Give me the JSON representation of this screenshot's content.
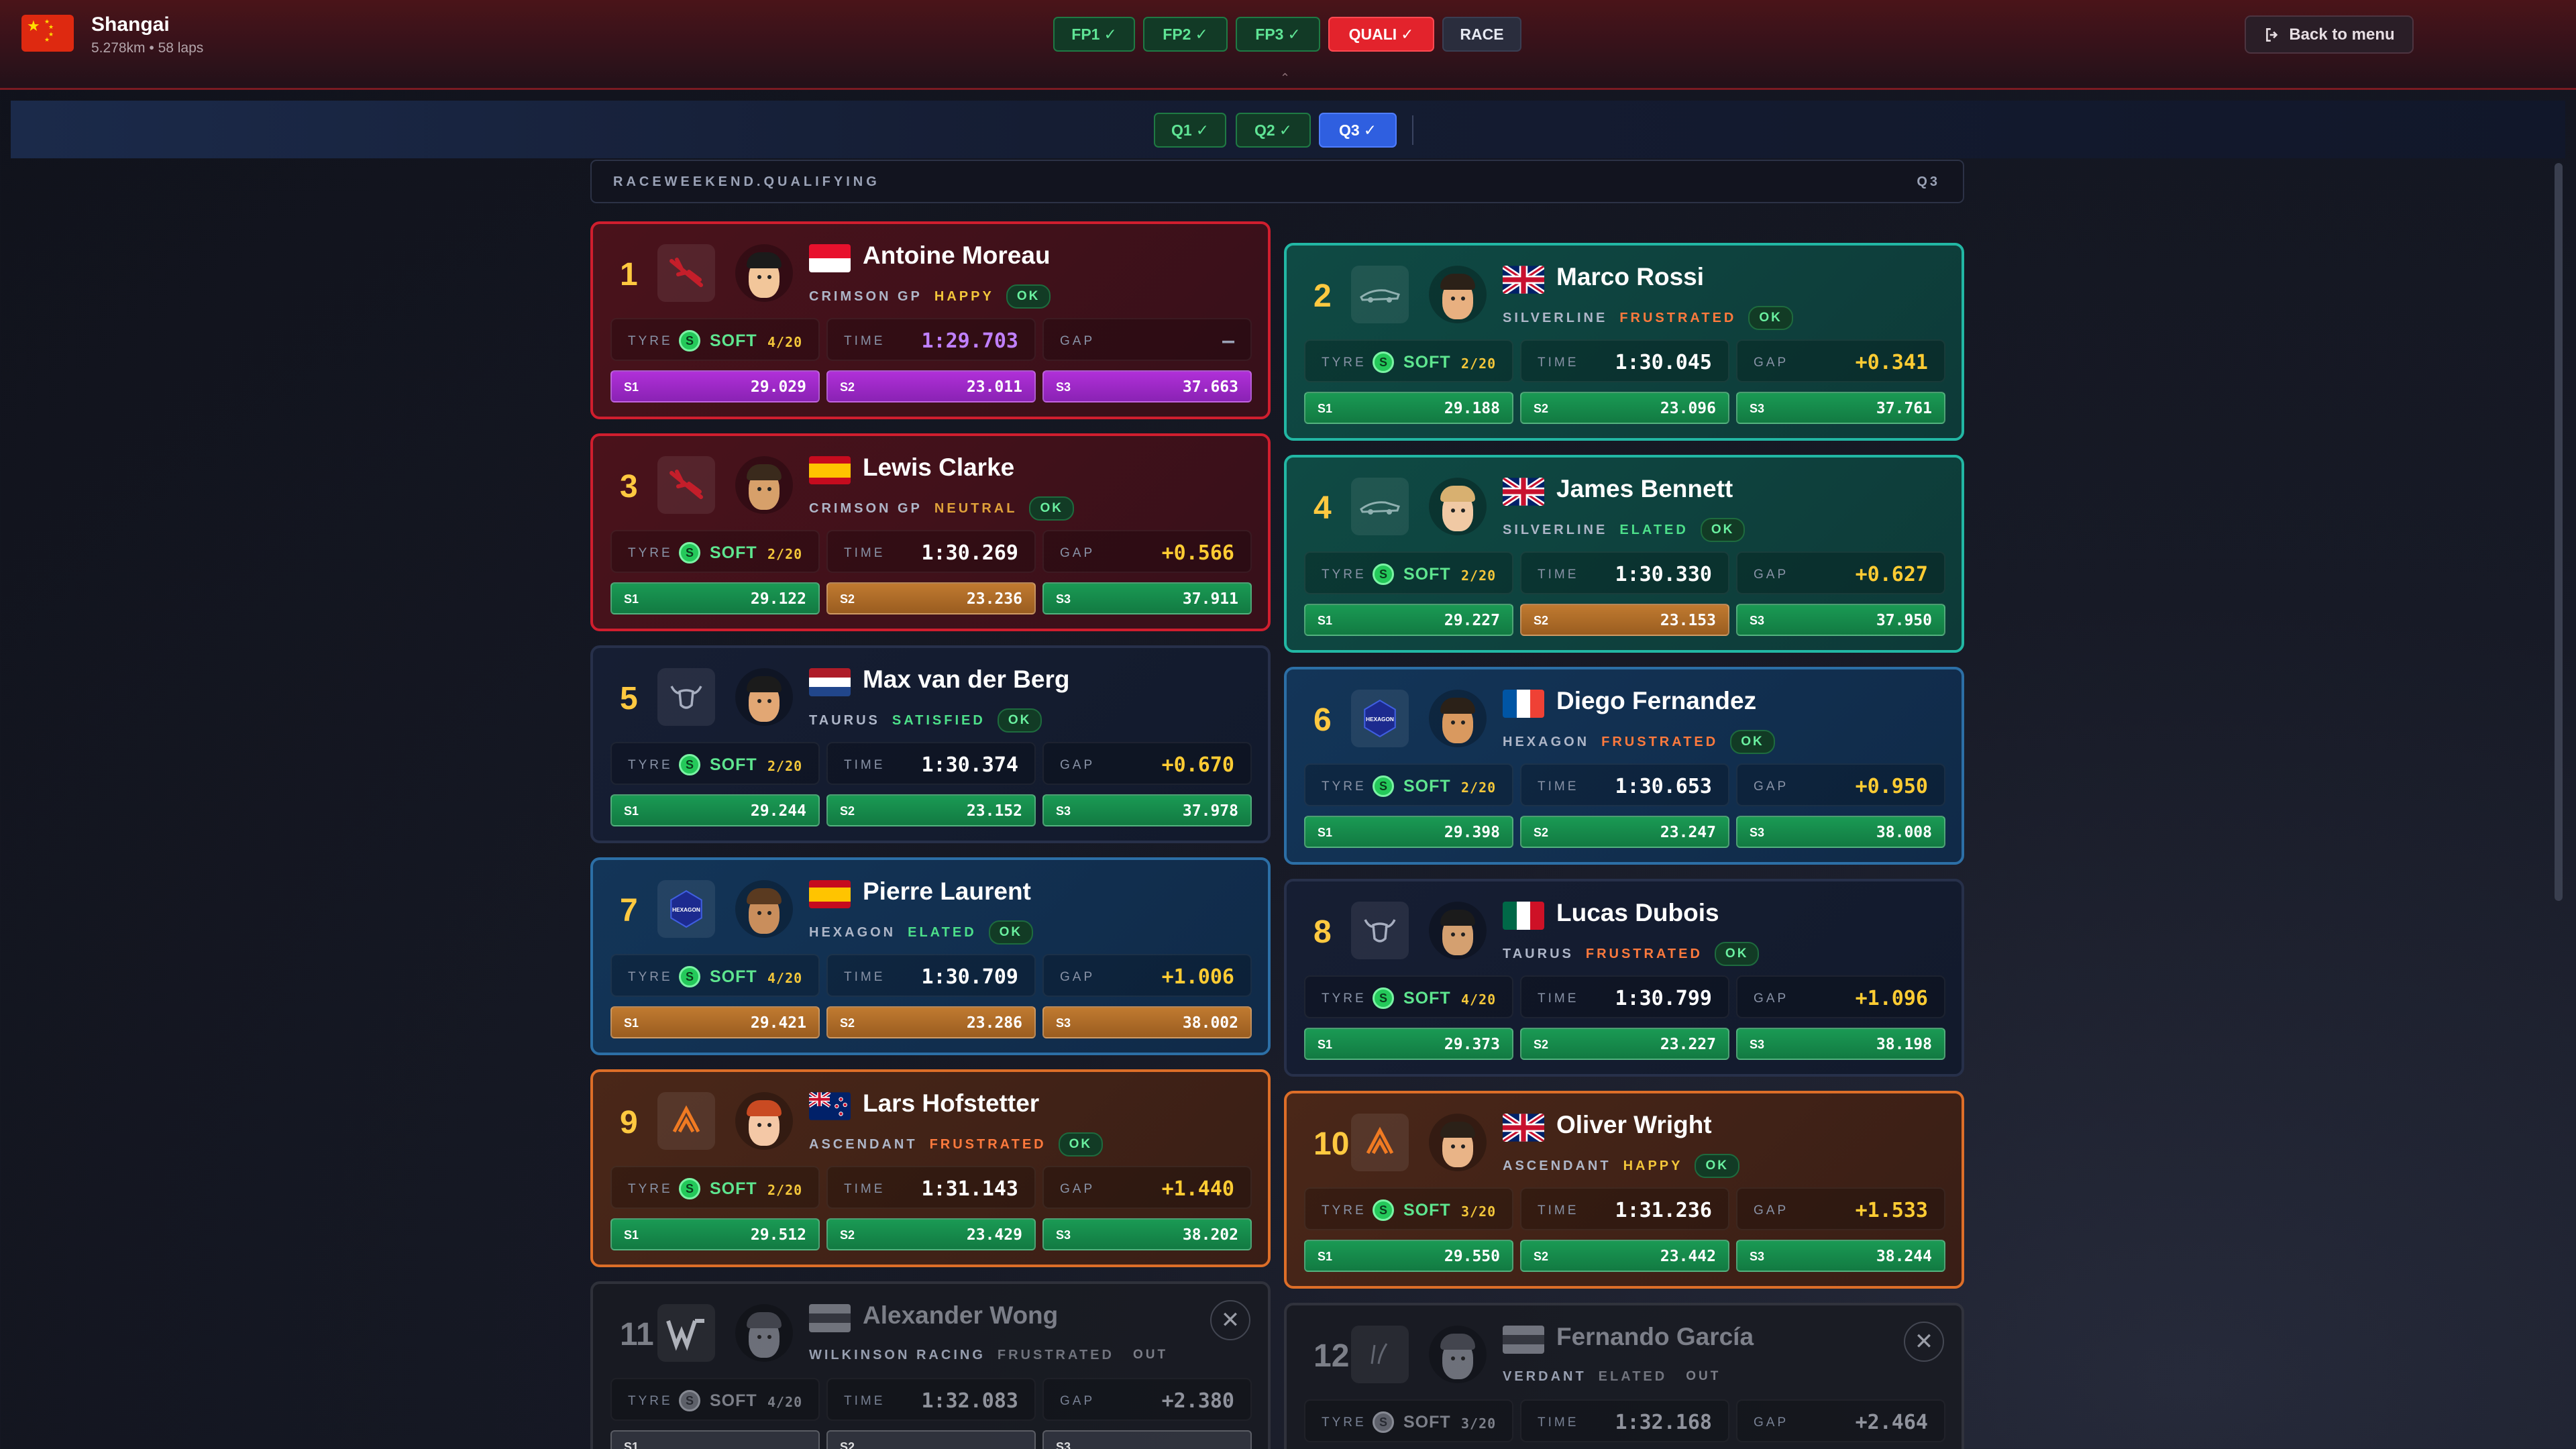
{
  "track": {
    "name": "Shangai",
    "info": "5.278km • 58 laps"
  },
  "sessions": [
    {
      "label": "FP1",
      "state": "done"
    },
    {
      "label": "FP2",
      "state": "done"
    },
    {
      "label": "FP3",
      "state": "done"
    },
    {
      "label": "QUALI",
      "state": "active"
    },
    {
      "label": "RACE",
      "state": "plain"
    }
  ],
  "check": "✓",
  "back_label": "Back to menu",
  "quali_tabs": [
    {
      "label": "Q1",
      "state": "done"
    },
    {
      "label": "Q2",
      "state": "done"
    },
    {
      "label": "Q3",
      "state": "active"
    }
  ],
  "ribbon": {
    "left": "RACEWEEKEND.QUALIFYING",
    "right": "Q3"
  },
  "labels": {
    "tyre": "TYRE",
    "time": "TIME",
    "gap": "GAP",
    "ok": "OK",
    "out": "OUT"
  },
  "colors": {
    "happy": "#f3c63a",
    "neutral": "#e0a23a",
    "frustrated": "#ff7a3d",
    "satisfied": "#4de08a",
    "elated": "#4de08a",
    "purple_sector": "#b030d8",
    "green_sector": "#1a9a54",
    "orange_sector": "#c07a30"
  },
  "drivers": [
    {
      "pos": "1",
      "name": "Antoine Moreau",
      "team": "CRIMSON GP",
      "team_key": "crimson",
      "mood": "HAPPY",
      "status": "OK",
      "flag": "monaco",
      "tyre": "SOFT",
      "tyre_age": "4/20",
      "time": "1:29.703",
      "gap": "–",
      "s1": "29.029",
      "s2": "23.011",
      "s3": "37.663",
      "sc": [
        "purple",
        "purple",
        "purple"
      ]
    },
    {
      "pos": "2",
      "name": "Marco Rossi",
      "team": "SILVERLINE",
      "team_key": "silver",
      "mood": "FRUSTRATED",
      "status": "OK",
      "flag": "uk",
      "tyre": "SOFT",
      "tyre_age": "2/20",
      "time": "1:30.045",
      "gap": "+0.341",
      "s1": "29.188",
      "s2": "23.096",
      "s3": "37.761",
      "sc": [
        "green",
        "green",
        "green"
      ]
    },
    {
      "pos": "3",
      "name": "Lewis Clarke",
      "team": "CRIMSON GP",
      "team_key": "crimson",
      "mood": "NEUTRAL",
      "status": "OK",
      "flag": "spain",
      "tyre": "SOFT",
      "tyre_age": "2/20",
      "time": "1:30.269",
      "gap": "+0.566",
      "s1": "29.122",
      "s2": "23.236",
      "s3": "37.911",
      "sc": [
        "green",
        "orange",
        "green"
      ]
    },
    {
      "pos": "4",
      "name": "James Bennett",
      "team": "SILVERLINE",
      "team_key": "silver",
      "mood": "ELATED",
      "status": "OK",
      "flag": "uk",
      "tyre": "SOFT",
      "tyre_age": "2/20",
      "time": "1:30.330",
      "gap": "+0.627",
      "s1": "29.227",
      "s2": "23.153",
      "s3": "37.950",
      "sc": [
        "green",
        "orange",
        "green"
      ]
    },
    {
      "pos": "5",
      "name": "Max van der Berg",
      "team": "TAURUS",
      "team_key": "taurus",
      "mood": "SATISFIED",
      "status": "OK",
      "flag": "netherlands",
      "tyre": "SOFT",
      "tyre_age": "2/20",
      "time": "1:30.374",
      "gap": "+0.670",
      "s1": "29.244",
      "s2": "23.152",
      "s3": "37.978",
      "sc": [
        "green",
        "green",
        "green"
      ]
    },
    {
      "pos": "6",
      "name": "Diego Fernandez",
      "team": "HEXAGON",
      "team_key": "hexagon",
      "mood": "FRUSTRATED",
      "status": "OK",
      "flag": "france",
      "tyre": "SOFT",
      "tyre_age": "2/20",
      "time": "1:30.653",
      "gap": "+0.950",
      "s1": "29.398",
      "s2": "23.247",
      "s3": "38.008",
      "sc": [
        "green",
        "green",
        "green"
      ]
    },
    {
      "pos": "7",
      "name": "Pierre Laurent",
      "team": "HEXAGON",
      "team_key": "hexagon",
      "mood": "ELATED",
      "status": "OK",
      "flag": "spain",
      "tyre": "SOFT",
      "tyre_age": "4/20",
      "time": "1:30.709",
      "gap": "+1.006",
      "s1": "29.421",
      "s2": "23.286",
      "s3": "38.002",
      "sc": [
        "orange",
        "orange",
        "orange"
      ]
    },
    {
      "pos": "8",
      "name": "Lucas Dubois",
      "team": "TAURUS",
      "team_key": "taurus",
      "mood": "FRUSTRATED",
      "status": "OK",
      "flag": "mexico",
      "tyre": "SOFT",
      "tyre_age": "4/20",
      "time": "1:30.799",
      "gap": "+1.096",
      "s1": "29.373",
      "s2": "23.227",
      "s3": "38.198",
      "sc": [
        "green",
        "green",
        "green"
      ]
    },
    {
      "pos": "9",
      "name": "Lars Hofstetter",
      "team": "ASCENDANT",
      "team_key": "ascendant",
      "mood": "FRUSTRATED",
      "status": "OK",
      "flag": "nz",
      "tyre": "SOFT",
      "tyre_age": "2/20",
      "time": "1:31.143",
      "gap": "+1.440",
      "s1": "29.512",
      "s2": "23.429",
      "s3": "38.202",
      "sc": [
        "green",
        "green",
        "green"
      ]
    },
    {
      "pos": "10",
      "name": "Oliver Wright",
      "team": "ASCENDANT",
      "team_key": "ascendant",
      "mood": "HAPPY",
      "status": "OK",
      "flag": "uk",
      "tyre": "SOFT",
      "tyre_age": "3/20",
      "time": "1:31.236",
      "gap": "+1.533",
      "s1": "29.550",
      "s2": "23.442",
      "s3": "38.244",
      "sc": [
        "green",
        "green",
        "green"
      ]
    },
    {
      "pos": "11",
      "name": "Alexander Wong",
      "team": "WILKINSON RACING",
      "team_key": "out",
      "mood": "FRUSTRATED",
      "status": "OUT",
      "flag": "grey",
      "tyre": "SOFT",
      "tyre_age": "4/20",
      "time": "1:32.083",
      "gap": "+2.380",
      "s1": "",
      "s2": "",
      "s3": "",
      "sc": [
        "grey",
        "grey",
        "grey"
      ]
    },
    {
      "pos": "12",
      "name": "Fernando García",
      "team": "VERDANT",
      "team_key": "out",
      "mood": "ELATED",
      "status": "OUT",
      "flag": "grey",
      "tyre": "SOFT",
      "tyre_age": "3/20",
      "time": "1:32.168",
      "gap": "+2.464",
      "s1": "",
      "s2": "",
      "s3": "",
      "sc": [
        "grey",
        "grey",
        "grey"
      ]
    }
  ]
}
